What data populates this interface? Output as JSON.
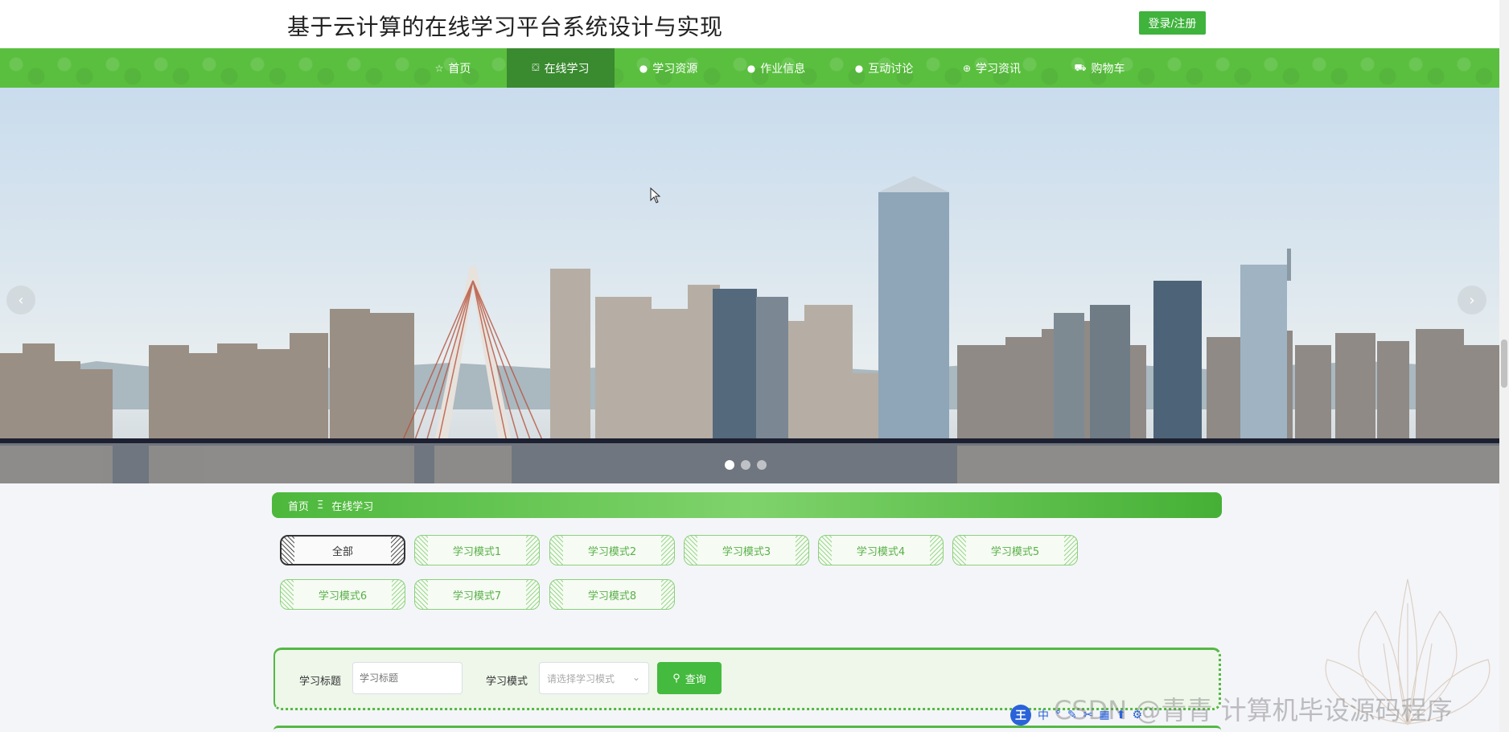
{
  "header": {
    "site_title": "基于云计算的在线学习平台系统设计与实现",
    "login_label": "登录/注册"
  },
  "nav": {
    "items": [
      {
        "label": "首页",
        "icon": "star-icon"
      },
      {
        "label": "在线学习",
        "icon": "bag-icon",
        "active": true
      },
      {
        "label": "学习资源",
        "icon": "info-icon"
      },
      {
        "label": "作业信息",
        "icon": "info-icon"
      },
      {
        "label": "互动讨论",
        "icon": "info-icon"
      },
      {
        "label": "学习资讯",
        "icon": "globe-icon"
      },
      {
        "label": "购物车",
        "icon": "cart-icon"
      }
    ]
  },
  "banner": {
    "arrow_left": "‹",
    "arrow_right": "›",
    "slide_count": 3,
    "active_slide": 0
  },
  "breadcrumb": {
    "home": "首页",
    "separator": "Ξ",
    "current": "在线学习"
  },
  "categories": {
    "items": [
      "全部",
      "学习模式1",
      "学习模式2",
      "学习模式3",
      "学习模式4",
      "学习模式5",
      "学习模式6",
      "学习模式7",
      "学习模式8"
    ],
    "active": "全部"
  },
  "search": {
    "title_label": "学习标题",
    "title_placeholder": "学习标题",
    "title_value": "",
    "mode_label": "学习模式",
    "mode_placeholder": "请选择学习模式",
    "button_label": "查询"
  },
  "overlay": {
    "watermark": "CSDN @青青  计算机毕设源码程序",
    "ime_logo": "王",
    "ime_items": [
      "中",
      "°",
      "✎",
      "✂",
      "▦",
      "⬆",
      "⚙"
    ]
  },
  "colors": {
    "brand_green": "#5abf3f",
    "active_nav": "#3a8a30",
    "button_green": "#44ba3e"
  }
}
